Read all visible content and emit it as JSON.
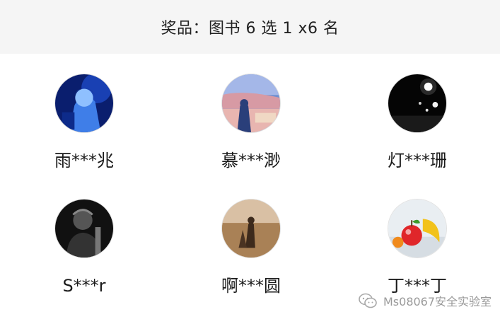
{
  "header": {
    "title": "奖品：图书 6 选 1 x6 名"
  },
  "winners": [
    {
      "name": "雨***兆",
      "avatar": "anime-character-avatar"
    },
    {
      "name": "慕***渺",
      "avatar": "evening-sky-photo-avatar"
    },
    {
      "name": "灯***珊",
      "avatar": "night-lights-avatar"
    },
    {
      "name": "S***r",
      "avatar": "dark-portrait-avatar"
    },
    {
      "name": "啊***圆",
      "avatar": "beach-couple-avatar"
    },
    {
      "name": "丁***丁",
      "avatar": "fruit-illustration-avatar"
    }
  ],
  "watermark": {
    "text": "Ms08067安全实验室",
    "icon": "wechat-icon"
  },
  "colors": {
    "header_bg": "#f5f5f5",
    "text": "#1a1a1a",
    "watermark": "#9a9a9a"
  }
}
